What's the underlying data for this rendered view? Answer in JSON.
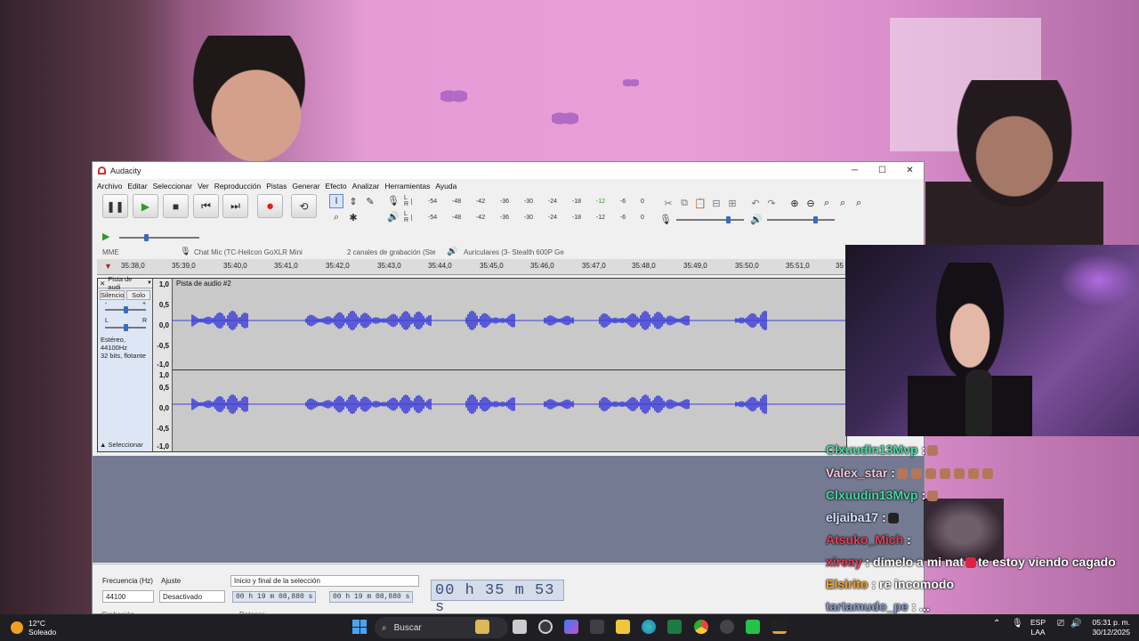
{
  "audacity": {
    "title": "Audacity",
    "window_controls": {
      "minimize": "─",
      "maximize": "☐",
      "close": "✕"
    },
    "menus": [
      "Archivo",
      "Editar",
      "Seleccionar",
      "Ver",
      "Reproducción",
      "Pistas",
      "Generar",
      "Efecto",
      "Analizar",
      "Herramientas",
      "Ayuda"
    ],
    "transport": {
      "pause": "❚❚",
      "play": "▶",
      "stop": "■",
      "skip_start": "⏮",
      "skip_end": "⏭",
      "record": "●",
      "loop": "⟲"
    },
    "meter_ticks": [
      "-54",
      "-48",
      "-42",
      "-36",
      "-30",
      "-24",
      "-18",
      "-12",
      "-6",
      "0"
    ],
    "meter_lr": {
      "l": "L",
      "r": "R"
    },
    "devices": {
      "host": "MME",
      "input": "Chat Mic (TC-Helicon GoXLR Mini",
      "channels": "2 canales de grabación (Ster",
      "output": "Auriculares (3- Stealth 600P Ge"
    },
    "ruler_ticks": [
      "35:38,0",
      "35:39,0",
      "35:40,0",
      "35:41,0",
      "35:42,0",
      "35:43,0",
      "35:44,0",
      "35:45,0",
      "35:46,0",
      "35:47,0",
      "35:48,0",
      "35:49,0",
      "35:50,0",
      "35:51,0",
      "35"
    ],
    "track": {
      "close": "✕",
      "header": "Pista de audi",
      "name": "Pista de audio #2",
      "mute": "Silencio",
      "solo": "Solo",
      "gain_minus": "-",
      "gain_plus": "+",
      "pan_l": "L",
      "pan_r": "R",
      "info_line1": "Estéreo, 44100Hz",
      "info_line2": "32 bits, flotante",
      "select": "▲ Seleccionar",
      "scale": [
        "1,0",
        "0,5",
        "0,0",
        "-0,5",
        "-1,0",
        "1,0",
        "0,5",
        "0,0",
        "-0,5",
        "-1,0"
      ]
    },
    "selection_bar": {
      "rate_label": "Frecuencia (Hz)",
      "rate_value": "44100",
      "snap_label": "Ajuste",
      "snap_value": "Desactivado",
      "sel_label": "Inicio y final de la selección",
      "sel_start": "00 h 19 m 08,880 s",
      "sel_end": "00 h 19 m 08,880 s",
      "time": "00 h 35 m 53 s",
      "bottom_left": "Grabación",
      "bottom_mid": "Detener"
    },
    "colors": {
      "waveform": "#3f3fd8",
      "track_bg": "#c9c9c9"
    }
  },
  "chat": [
    {
      "user": "Clxuudin13Mvp",
      "color": "#4dd6a8",
      "text": ":"
    },
    {
      "user": "Valex_star",
      "color": "#f2c9d7",
      "text": ":"
    },
    {
      "user": "Clxuudin13Mvp",
      "color": "#4dd6a8",
      "text": ":"
    },
    {
      "user": "eljaiba17",
      "color": "#d9e4ff",
      "text": ":"
    },
    {
      "user": "Atsuko_Mich",
      "color": "#e0405a",
      "text": ":"
    },
    {
      "user": "xireay",
      "color": "#e0405a",
      "text": ": dímelo a mi nat",
      "text2": "te estoy viendo cagado"
    },
    {
      "user": "Elsirito",
      "color": "#f0a030",
      "text": ": re incomodo"
    },
    {
      "user": "tartamudo_pe",
      "color": "#8899cc",
      "text": ": ..."
    }
  ],
  "taskbar": {
    "temp": "12°C",
    "weather": "Soleado",
    "search": "Buscar",
    "lang_top": "ESP",
    "lang_bottom": "LAA",
    "time": "05:31 p. m.",
    "date": "30/12/2025"
  }
}
